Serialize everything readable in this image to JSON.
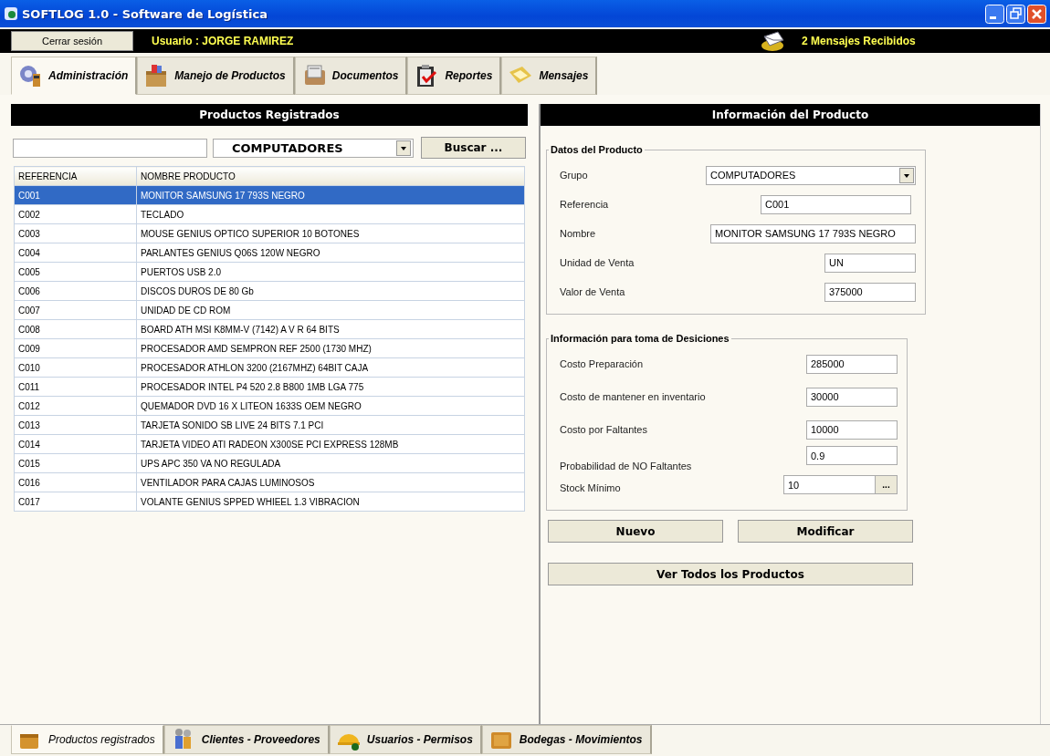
{
  "window": {
    "title": "SOFTLOG 1.0  - Software de Logística"
  },
  "user_bar": {
    "logout_button": "Cerrar sesión",
    "user": "Usuario : JORGE RAMIREZ",
    "messages": "2 Mensajes Recibidos"
  },
  "tabs": [
    {
      "label": "Administración",
      "selected": true
    },
    {
      "label": "Manejo de Productos",
      "selected": false
    },
    {
      "label": "Documentos",
      "selected": false
    },
    {
      "label": "Reportes",
      "selected": false
    },
    {
      "label": "Mensajes",
      "selected": false
    }
  ],
  "products_panel": {
    "title": "Productos Registrados",
    "group_select": "COMPUTADORES",
    "search_button": "Buscar ...",
    "columns": [
      "REFERENCIA",
      "NOMBRE PRODUCTO"
    ],
    "rows": [
      {
        "ref": "C001",
        "name": "MONITOR SAMSUNG 17 793S NEGRO",
        "selected": true
      },
      {
        "ref": "C002",
        "name": "TECLADO",
        "selected": false
      },
      {
        "ref": "C003",
        "name": "MOUSE GENIUS OPTICO SUPERIOR 10 BOTONES",
        "selected": false
      },
      {
        "ref": "C004",
        "name": "PARLANTES GENIUS Q06S 120W NEGRO",
        "selected": false
      },
      {
        "ref": "C005",
        "name": "PUERTOS USB 2.0",
        "selected": false
      },
      {
        "ref": "C006",
        "name": "DISCOS DUROS DE 80 Gb",
        "selected": false
      },
      {
        "ref": "C007",
        "name": "UNIDAD DE CD ROM",
        "selected": false
      },
      {
        "ref": "C008",
        "name": "BOARD ATH MSI K8MM-V (7142) A V R 64 BITS",
        "selected": false
      },
      {
        "ref": "C009",
        "name": "PROCESADOR AMD SEMPRON REF 2500 (1730 MHZ)",
        "selected": false
      },
      {
        "ref": "C010",
        "name": "PROCESADOR ATHLON 3200 (2167MHZ) 64BIT CAJA",
        "selected": false
      },
      {
        "ref": "C011",
        "name": "PROCESADOR INTEL P4 520 2.8 B800 1MB LGA 775",
        "selected": false
      },
      {
        "ref": "C012",
        "name": "QUEMADOR DVD 16 X LITEON 1633S OEM NEGRO",
        "selected": false
      },
      {
        "ref": "C013",
        "name": "TARJETA SONIDO SB LIVE 24 BITS 7.1 PCI",
        "selected": false
      },
      {
        "ref": "C014",
        "name": "TARJETA VIDEO ATI RADEON X300SE PCI EXPRESS 128MB",
        "selected": false
      },
      {
        "ref": "C015",
        "name": "UPS APC 350 VA NO REGULADA",
        "selected": false
      },
      {
        "ref": "C016",
        "name": "VENTILADOR PARA CAJAS LUMINOSOS",
        "selected": false
      },
      {
        "ref": "C017",
        "name": "VOLANTE GENIUS SPPED WHIEEL 1.3 VIBRACION",
        "selected": false
      }
    ]
  },
  "product_info": {
    "title": "Información del Producto",
    "sections": [
      {
        "legend": "Datos del Producto",
        "fields": [
          {
            "label": "Grupo",
            "value": "COMPUTADORES",
            "kind": "select"
          },
          {
            "label": "Referencia",
            "value": "C001",
            "kind": "text"
          },
          {
            "label": "Nombre",
            "value": "MONITOR SAMSUNG 17 793S NEGRO",
            "kind": "text"
          },
          {
            "label": "Unidad de Venta",
            "value": "UN",
            "kind": "text"
          },
          {
            "label": "Valor de Venta",
            "value": "375000",
            "kind": "text"
          }
        ]
      },
      {
        "legend": "Información para toma de Desiciones",
        "fields": [
          {
            "label": "Costo Preparación",
            "value": "285000",
            "kind": "text"
          },
          {
            "label": "Costo de mantener en inventario",
            "value": "30000",
            "kind": "text"
          },
          {
            "label": "Costo por Faltantes",
            "value": "10000",
            "kind": "text"
          },
          {
            "label": "Probabilidad de NO Faltantes",
            "value": "0.9",
            "kind": "text"
          },
          {
            "label": "Stock Mínimo",
            "value": "10",
            "kind": "picker",
            "button": "..."
          }
        ]
      }
    ],
    "buttons": [
      "Nuevo",
      "Modificar"
    ],
    "all_button": "Ver Todos los Productos"
  },
  "bottom_tabs": [
    {
      "label": "Productos registrados",
      "selected": true
    },
    {
      "label": "Clientes - Proveedores",
      "selected": false
    },
    {
      "label": "Usuarios - Permisos",
      "selected": false
    },
    {
      "label": "Bodegas - Movimientos",
      "selected": false
    }
  ]
}
